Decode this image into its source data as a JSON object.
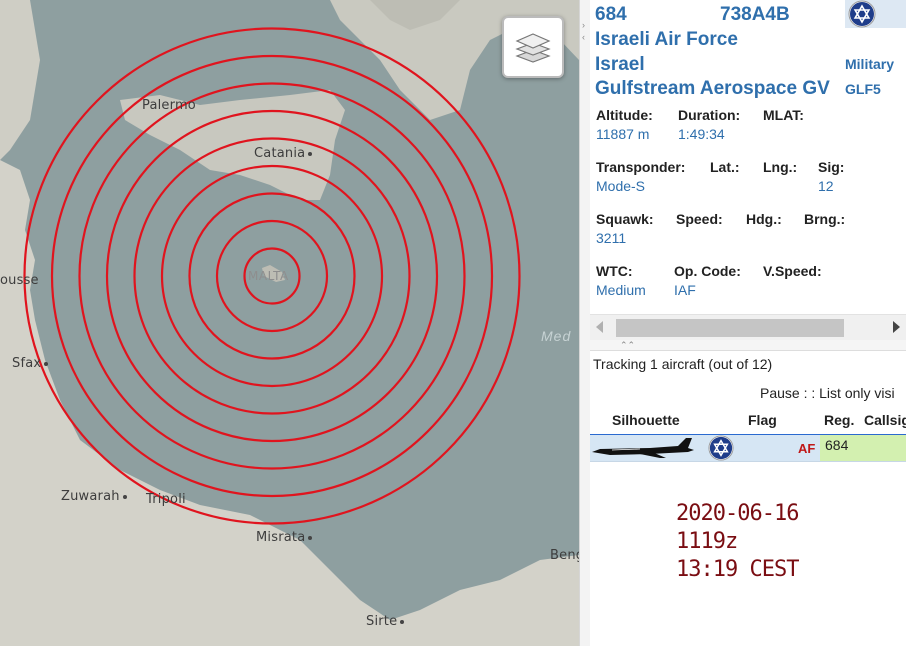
{
  "map": {
    "cities": [
      {
        "id": "palermo",
        "name": "Palermo"
      },
      {
        "id": "catania",
        "name": "Catania"
      },
      {
        "id": "sousse",
        "name": "ousse"
      },
      {
        "id": "sfax",
        "name": "Sfax"
      },
      {
        "id": "zuwarah",
        "name": "Zuwarah"
      },
      {
        "id": "tripoli",
        "name": "Tripoli"
      },
      {
        "id": "misrata",
        "name": "Misrata"
      },
      {
        "id": "sirte",
        "name": "Sirte"
      },
      {
        "id": "benghazi",
        "name": "Beng"
      }
    ],
    "malta_label": "MALTA",
    "sea_label": "Med",
    "ring_color": "#e0141e",
    "ring_count": 9
  },
  "aircraft": {
    "callsign": "684",
    "hex": "738A4B",
    "operator": "Israeli Air Force",
    "country": "Israel",
    "category": "Military",
    "type": "Gulfstream Aerospace GV",
    "type_code": "GLF5",
    "fields": {
      "altitude_label": "Altitude:",
      "altitude": "11887 m",
      "duration_label": "Duration:",
      "duration": "1:49:34",
      "mlat_label": "MLAT:",
      "transponder_label": "Transponder:",
      "transponder": "Mode-S",
      "lat_label": "Lat.:",
      "lng_label": "Lng.:",
      "sig_label": "Sig:",
      "sig": "12",
      "squawk_label": "Squawk:",
      "squawk": "3211",
      "speed_label": "Speed:",
      "hdg_label": "Hdg.:",
      "brng_label": "Brng.:",
      "wtc_label": "WTC:",
      "wtc": "Medium",
      "opcode_label": "Op. Code:",
      "opcode": "IAF",
      "vspeed_label": "V.Speed:"
    }
  },
  "list": {
    "tracking_text": "Tracking 1 aircraft (out of 12)",
    "pause_text": "Pause : : List only visi",
    "headers": {
      "silhouette": "Silhouette",
      "flag": "Flag",
      "reg": "Reg.",
      "callsign": "Callsig"
    },
    "row": {
      "op": "AF",
      "reg": "684"
    }
  },
  "stamp": {
    "date": "2020-06-16",
    "zulu": "1119z",
    "local": "13:19  CEST"
  }
}
